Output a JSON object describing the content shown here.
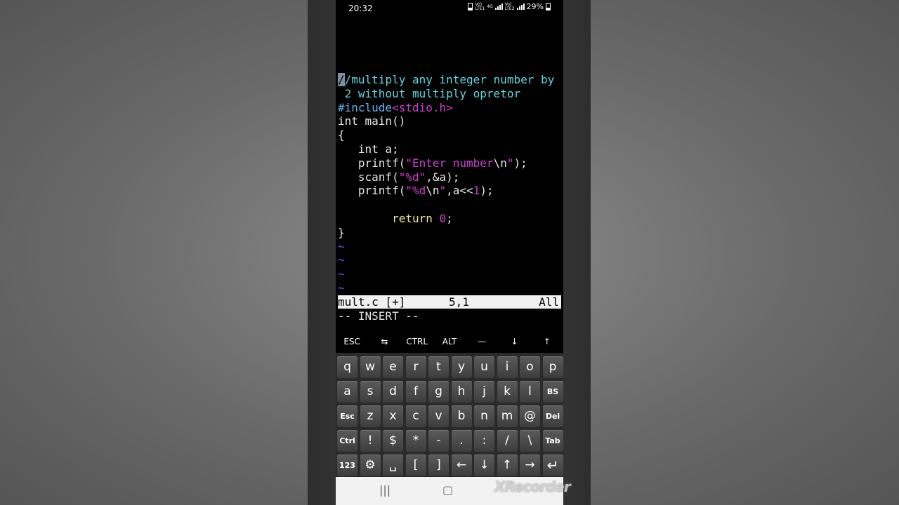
{
  "status_bar": {
    "time": "20:32",
    "sim1_top": "Vo)",
    "sim1_bottom": "LTE1",
    "net": "4G",
    "sim2_top": "Vo)",
    "sim2_bottom": "LTE2",
    "battery": "29%"
  },
  "editor": {
    "lines": [
      {
        "segments": [
          {
            "t": "/",
            "cls": "cmt cursor"
          },
          {
            "t": "/multiply any integer number by",
            "cls": "cmt"
          }
        ]
      },
      {
        "segments": [
          {
            "t": " 2 without multiply opretor",
            "cls": "cmt"
          }
        ]
      },
      {
        "segments": [
          {
            "t": "#include",
            "cls": "pre"
          },
          {
            "t": "<stdio.h>",
            "cls": "str"
          }
        ]
      },
      {
        "segments": [
          {
            "t": "int main()",
            "cls": ""
          }
        ]
      },
      {
        "segments": [
          {
            "t": "{",
            "cls": ""
          }
        ]
      },
      {
        "segments": [
          {
            "t": "   int a;",
            "cls": ""
          }
        ]
      },
      {
        "segments": [
          {
            "t": "   printf(",
            "cls": ""
          },
          {
            "t": "\"Enter number",
            "cls": "str"
          },
          {
            "t": "\\n",
            "cls": ""
          },
          {
            "t": "\"",
            "cls": "str"
          },
          {
            "t": ");",
            "cls": ""
          }
        ]
      },
      {
        "segments": [
          {
            "t": "   scanf(",
            "cls": ""
          },
          {
            "t": "\"%d\"",
            "cls": "str"
          },
          {
            "t": ",&a);",
            "cls": ""
          }
        ]
      },
      {
        "segments": [
          {
            "t": "   printf(",
            "cls": ""
          },
          {
            "t": "\"%d",
            "cls": "str"
          },
          {
            "t": "\\n",
            "cls": ""
          },
          {
            "t": "\"",
            "cls": "str"
          },
          {
            "t": ",a<<",
            "cls": ""
          },
          {
            "t": "1",
            "cls": "num"
          },
          {
            "t": ");",
            "cls": ""
          }
        ]
      },
      {
        "segments": [
          {
            "t": "",
            "cls": ""
          }
        ]
      },
      {
        "segments": [
          {
            "t": "        ",
            "cls": ""
          },
          {
            "t": "return",
            "cls": "ret"
          },
          {
            "t": " ",
            "cls": ""
          },
          {
            "t": "0",
            "cls": "num"
          },
          {
            "t": ";",
            "cls": ""
          }
        ]
      },
      {
        "segments": [
          {
            "t": "}",
            "cls": ""
          }
        ]
      },
      {
        "segments": [
          {
            "t": "~",
            "cls": "tilde"
          }
        ]
      },
      {
        "segments": [
          {
            "t": "~",
            "cls": "tilde"
          }
        ]
      },
      {
        "segments": [
          {
            "t": "~",
            "cls": "tilde"
          }
        ]
      },
      {
        "segments": [
          {
            "t": "~",
            "cls": "tilde"
          }
        ]
      }
    ],
    "status_file": "mult.c [+]",
    "status_pos": "5,1",
    "status_all": "All",
    "mode": "-- INSERT --"
  },
  "extra_keys": [
    "ESC",
    "⇆",
    "CTRL",
    "ALT",
    "—",
    "↓",
    "↑"
  ],
  "keyboard": {
    "rows": [
      [
        "q",
        "w",
        "e",
        "r",
        "t",
        "y",
        "u",
        "i",
        "o",
        "p"
      ],
      [
        "a",
        "s",
        "d",
        "f",
        "g",
        "h",
        "j",
        "k",
        "l",
        "BS"
      ],
      [
        "Esc",
        "z",
        "x",
        "c",
        "v",
        "b",
        "n",
        "m",
        "@",
        "Del"
      ],
      [
        "Ctrl",
        "!",
        "$",
        "*",
        "-",
        ".",
        ":",
        "/",
        "\\",
        "Tab"
      ],
      [
        "123",
        "⚙",
        "␣",
        "[",
        "]",
        "←",
        "↓",
        "↑",
        "→",
        "↵"
      ]
    ]
  },
  "nav_bar": {
    "recents": "|||",
    "home": "▢"
  },
  "watermark": "XRecorder"
}
